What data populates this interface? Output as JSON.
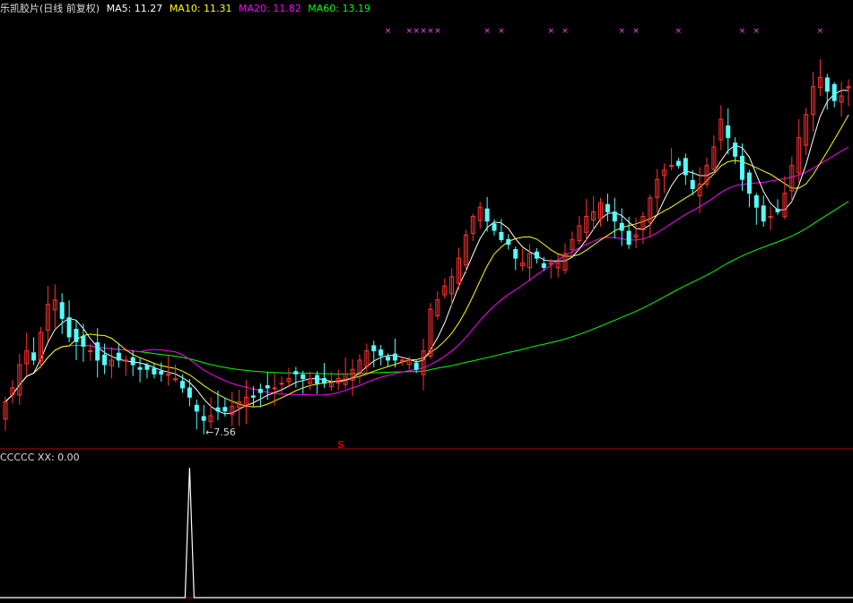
{
  "header": {
    "title": "乐凯胶片(日线 前复权)",
    "ma5": "MA5: 11.27",
    "ma10": "MA10: 11.31",
    "ma20": "MA20: 11.82",
    "ma60": "MA60: 13.19"
  },
  "sub_header": {
    "name": "CCCCC",
    "xx": "XX: 0.00"
  },
  "colors": {
    "up": "#ff3232",
    "down": "#54ffff",
    "ma5": "#ffffff",
    "ma10": "#ffff00",
    "ma20": "#ff00ff",
    "ma60": "#00ff00",
    "divider": "#c00000",
    "marker": "#ff44ff"
  },
  "chart_data": [
    {
      "type": "candlestick",
      "title": "乐凯胶片(日线 前复权)",
      "ylim": [
        7.2,
        15.9
      ],
      "annotations": {
        "low_label": "7.56",
        "signal_label": "S"
      },
      "close": [
        8.1,
        8.4,
        8.9,
        9.2,
        9.0,
        9.6,
        10.2,
        10.3,
        9.9,
        9.5,
        9.4,
        9.3,
        9.2,
        9.0,
        8.9,
        9.0,
        9.0,
        9.0,
        8.9,
        8.8,
        8.8,
        8.7,
        8.7,
        8.7,
        8.6,
        8.4,
        8.2,
        7.9,
        7.7,
        7.8,
        7.9,
        7.9,
        8.0,
        8.1,
        8.2,
        8.2,
        8.3,
        8.4,
        8.4,
        8.5,
        8.6,
        8.7,
        8.6,
        8.6,
        8.5,
        8.5,
        8.5,
        8.6,
        8.7,
        8.8,
        9.0,
        9.2,
        9.2,
        9.1,
        9.0,
        9.0,
        9.0,
        9.0,
        8.8,
        9.2,
        10.1,
        10.3,
        10.6,
        10.8,
        11.2,
        11.7,
        12.1,
        12.3,
        12.0,
        11.8,
        11.6,
        11.5,
        11.2,
        11.1,
        11.3,
        11.2,
        11.0,
        11.1,
        11.1,
        11.3,
        11.6,
        11.9,
        12.1,
        12.2,
        12.4,
        12.2,
        12.0,
        11.8,
        11.5,
        11.7,
        12.1,
        12.5,
        12.9,
        13.1,
        13.2,
        13.2,
        13.0,
        12.7,
        12.8,
        13.2,
        13.6,
        14.2,
        13.8,
        13.4,
        12.9,
        12.6,
        12.3,
        12.0,
        12.1,
        12.2,
        12.6,
        13.2,
        13.8,
        14.3,
        14.9,
        15.1,
        14.8,
        14.6,
        14.7,
        14.9
      ]
    },
    {
      "type": "line",
      "series": [
        {
          "name": "XX",
          "values": [
            0.0,
            0.0,
            1.0,
            0.0,
            0.0
          ]
        }
      ],
      "spike_at_index": 26,
      "ylim": [
        0,
        1
      ]
    }
  ]
}
